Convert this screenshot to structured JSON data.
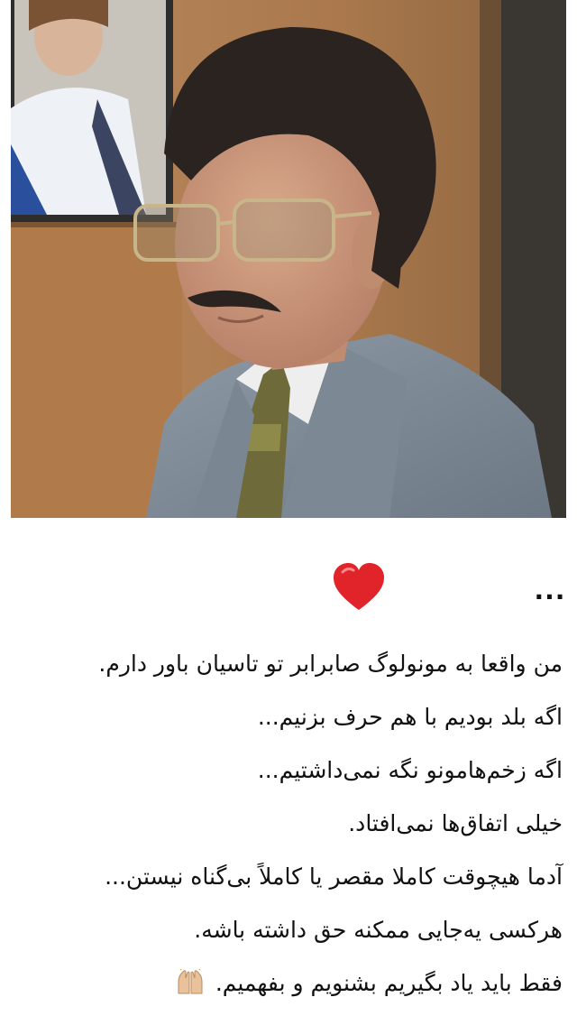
{
  "post": {
    "photo_alt": "man in grey suit with glasses",
    "menu_label": "...",
    "caption_lines": [
      "من واقعا به مونولوگ صابرابر تو تاسیان باور دارم.",
      "اگه بلد بودیم با هم حرف بزنیم...",
      "اگه زخم‌هامونو نگه نمی‌داشتیم...",
      "خیلی اتفاق‌ها نمی‌افتاد.",
      "آدما هیچوقت کاملا مقصر یا کاملاً بی‌گناه نیستن...",
      "هرکسی یه‌جایی ممکنه حق داشته باشه.",
      "فقط باید یاد بگیریم بشنویم و بفهمیم."
    ],
    "icons": {
      "heart": "red-heart-icon",
      "raised_hands": "raised-hands-icon",
      "more": "more-options-icon"
    },
    "colors": {
      "heart": "#e0242a",
      "text": "#111111",
      "background": "#ffffff"
    }
  }
}
